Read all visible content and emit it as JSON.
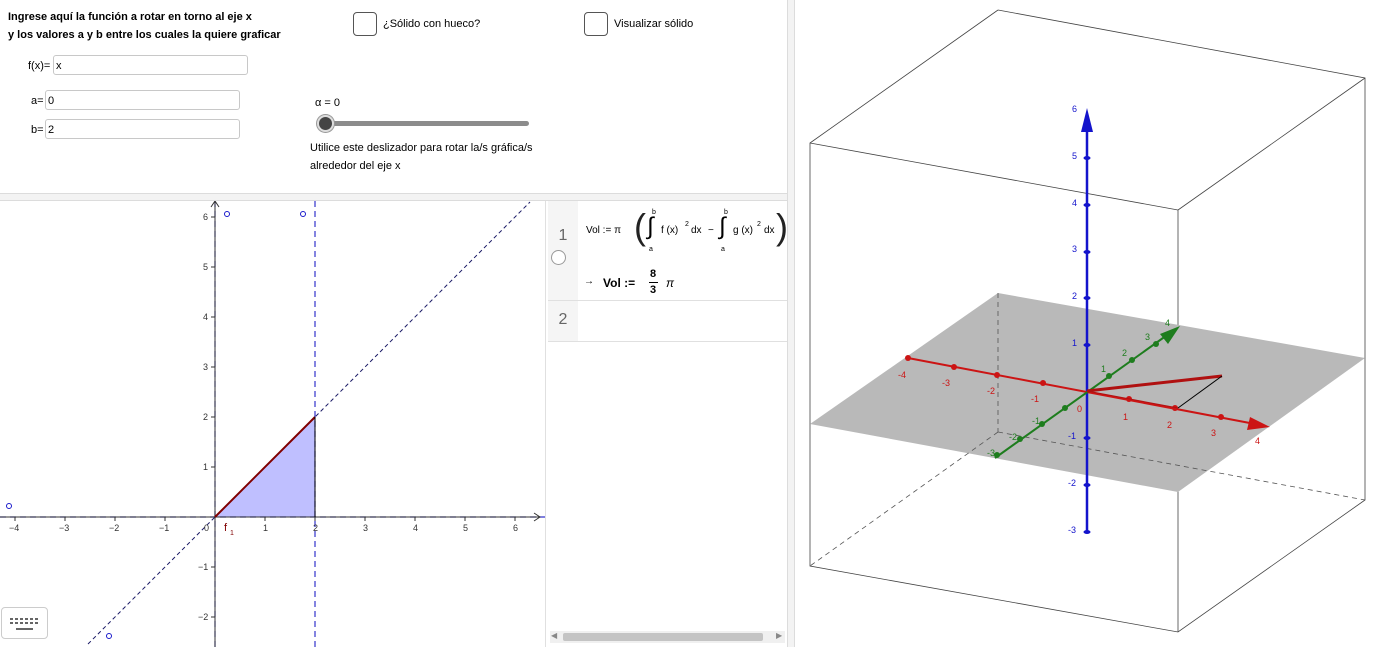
{
  "top_panel": {
    "instruction_line1": "Ingrese aquí la función a rotar en torno al eje x",
    "instruction_line2": "y los valores a y b entre los cuales la quiere graficar",
    "fx_label": "f(x)=",
    "fx_value": "x",
    "a_label": "a=",
    "a_value": "0",
    "b_label": "b=",
    "b_value": "2",
    "checkbox_hollow_label": "¿Sólido con hueco?",
    "checkbox_show_label": "Visualizar sólido",
    "slider_label": "α = 0",
    "slider_value": 0,
    "slider_hint_line1": "Utilice este deslizador para rotar la/s gráfica/s",
    "slider_hint_line2": "alrededor del eje x"
  },
  "graphics2d": {
    "x_ticks": [
      "−4",
      "−3",
      "−2",
      "−1",
      "0",
      "1",
      "2",
      "3",
      "4",
      "5",
      "6"
    ],
    "y_ticks": [
      "6",
      "5",
      "4",
      "3",
      "2",
      "1",
      "−1",
      "−2"
    ],
    "curve_label": "f",
    "curve_label_sub": "1"
  },
  "algebra": {
    "row1_number": "1",
    "row1_formula_prefix": "Vol := π",
    "row1_term1": "f (x)",
    "row1_term2": "g (x)",
    "row1_dx": "dx",
    "row1_minus": "−",
    "row1_upper": "b",
    "row1_lower": "a",
    "row1_sq": "2",
    "row1_result_arrow": "→",
    "row1_result_name": "Vol :=",
    "row1_result_num": "8",
    "row1_result_den": "3",
    "row1_result_pi": "π",
    "row2_number": "2"
  },
  "graphics3d": {
    "z_ticks": [
      "6",
      "5",
      "4",
      "3",
      "2",
      "1",
      "-1",
      "-2",
      "-3"
    ],
    "x_ticks": [
      "-4",
      "-3",
      "-2",
      "-1",
      "0",
      "1",
      "2",
      "3",
      "4"
    ],
    "y_ticks": [
      "-3",
      "-2",
      "-1",
      "1",
      "2",
      "3",
      "4"
    ],
    "colors": {
      "x_axis": "#cc1414",
      "y_axis": "#1e7d1e",
      "z_axis": "#1414cc",
      "plane": "#b9b9b9"
    }
  },
  "icons": {
    "keyboard": "keyboard-icon"
  }
}
